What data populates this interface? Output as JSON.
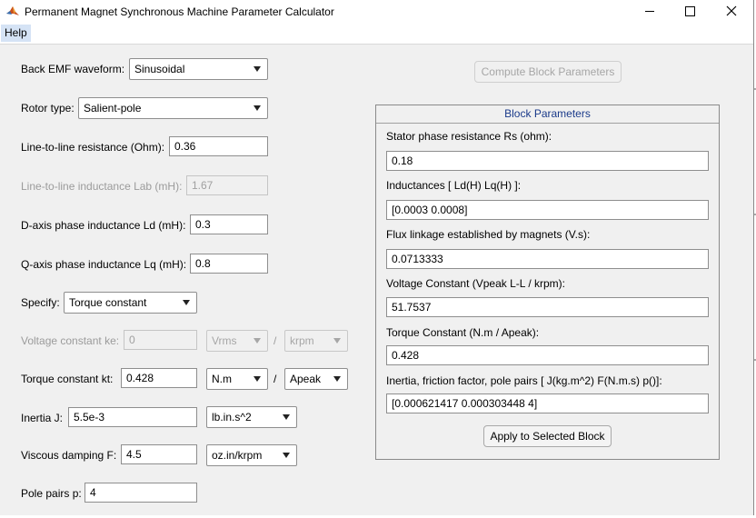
{
  "window": {
    "title": "Permanent Magnet Synchronous Machine Parameter Calculator",
    "menu": {
      "help": "Help"
    }
  },
  "form": {
    "back_emf": {
      "label": "Back EMF waveform:",
      "value": "Sinusoidal"
    },
    "rotor_type": {
      "label": "Rotor type:",
      "value": "Salient-pole"
    },
    "line_resistance": {
      "label": "Line-to-line resistance (Ohm):",
      "value": "0.36"
    },
    "line_inductance": {
      "label": "Line-to-line inductance Lab (mH):",
      "value": "1.67"
    },
    "d_inductance": {
      "label": "D-axis phase inductance Ld (mH):",
      "value": "0.3"
    },
    "q_inductance": {
      "label": "Q-axis phase inductance Lq (mH):",
      "value": "0.8"
    },
    "specify": {
      "label": "Specify:",
      "value": "Torque constant"
    },
    "voltage_constant": {
      "label": "Voltage constant ke:",
      "value": "0",
      "unit1": "Vrms",
      "separator": "/",
      "unit2": "krpm"
    },
    "torque_constant": {
      "label": "Torque constant  kt:",
      "value": "0.428",
      "unit1": "N.m",
      "separator": "/",
      "unit2": "Apeak"
    },
    "inertia": {
      "label": "Inertia J:",
      "value": "5.5e-3",
      "unit": "lb.in.s^2"
    },
    "viscous": {
      "label": "Viscous damping F:",
      "value": "4.5",
      "unit": "oz.in/krpm"
    },
    "pole_pairs": {
      "label": "Pole pairs p:",
      "value": "4"
    }
  },
  "compute_button": "Compute Block Parameters",
  "panel": {
    "title": "Block Parameters",
    "rows": [
      {
        "label": "Stator phase resistance Rs (ohm):",
        "value": "0.18"
      },
      {
        "label": "Inductances [ Ld(H) Lq(H) ]:",
        "value": "[0.0003 0.0008]"
      },
      {
        "label": "Flux linkage established by magnets (V.s):",
        "value": "0.0713333"
      },
      {
        "label": "Voltage Constant (Vpeak L-L / krpm):",
        "value": "51.7537"
      },
      {
        "label": "Torque Constant (N.m / Apeak):",
        "value": "0.428"
      },
      {
        "label": "Inertia, friction factor, pole pairs [ J(kg.m^2)  F(N.m.s)  p()]:",
        "value": "[0.000621417 0.000303448 4]"
      }
    ],
    "apply_button": "Apply to Selected Block"
  },
  "colors": {
    "panel_title": "#1a3a8a",
    "menu_highlight": "#d5e3f5",
    "disabled_text": "#9b9b9b"
  },
  "icons": {
    "app": "matlab-logo-icon",
    "minimize": "minimize-icon",
    "maximize": "maximize-icon",
    "close": "close-icon"
  }
}
